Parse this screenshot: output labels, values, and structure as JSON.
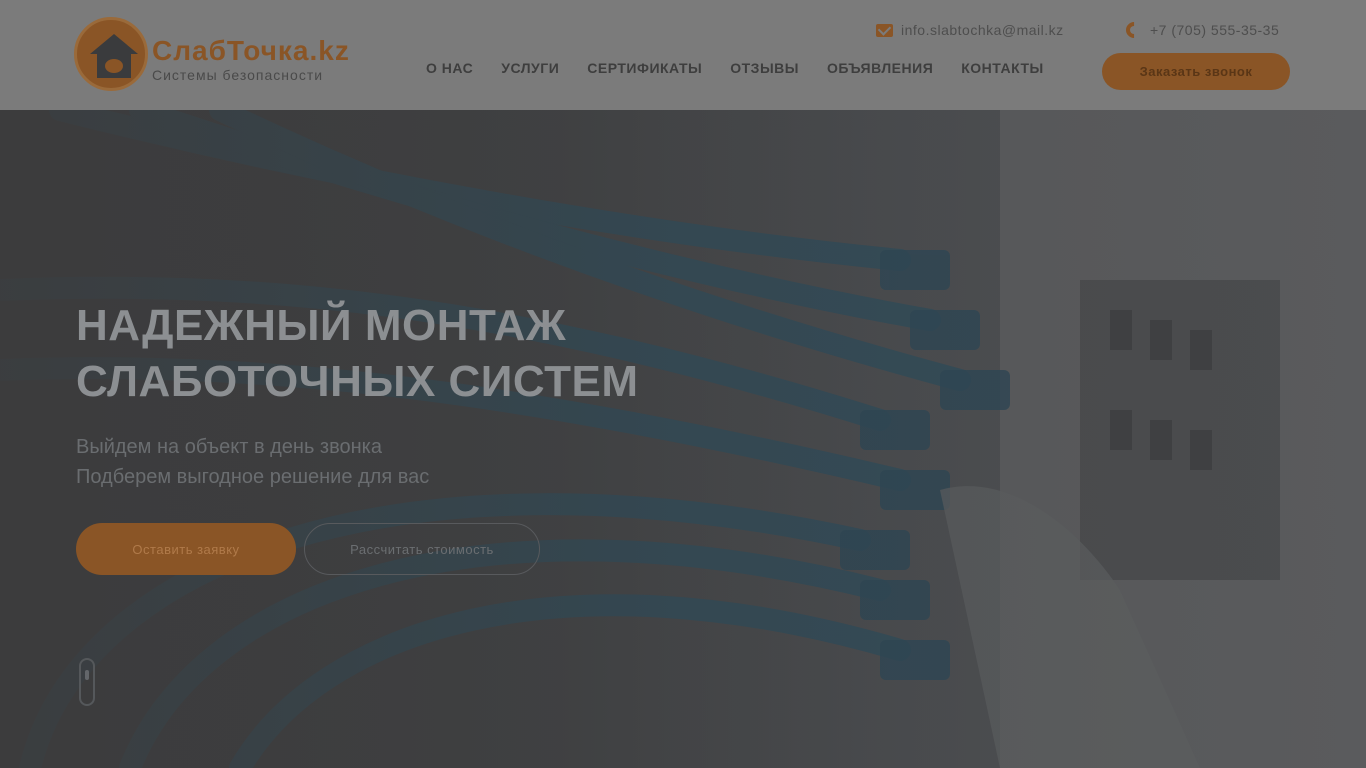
{
  "header": {
    "logo": {
      "brand": "СлабТочка.kz",
      "tagline": "Системы безопасности"
    },
    "contacts": {
      "email": "info.slabtochka@mail.kz",
      "phone": "+7 (705) 555-35-35"
    },
    "nav": [
      {
        "label": "О нас"
      },
      {
        "label": "Услуги"
      },
      {
        "label": "Сертификаты"
      },
      {
        "label": "Отзывы"
      },
      {
        "label": "Объявления"
      },
      {
        "label": "Контакты"
      }
    ],
    "cta_label": "Заказать звонок"
  },
  "hero": {
    "title_line1": "Надежный монтаж",
    "title_line2": "слаботочных систем",
    "subtitle_line1": "Выйдем на объект в день звонка",
    "subtitle_line2": "Подберем выгодное решение для вас",
    "primary_button": "Оставить заявку",
    "secondary_button": "Рассчитать стоимость"
  },
  "colors": {
    "accent": "#8a5526",
    "header_bg": "#7b7b7b",
    "hero_bg": "#3c3c3d"
  },
  "icons": {
    "email": "mail-icon",
    "phone": "phone-icon",
    "scroll": "mouse-scroll-icon"
  }
}
